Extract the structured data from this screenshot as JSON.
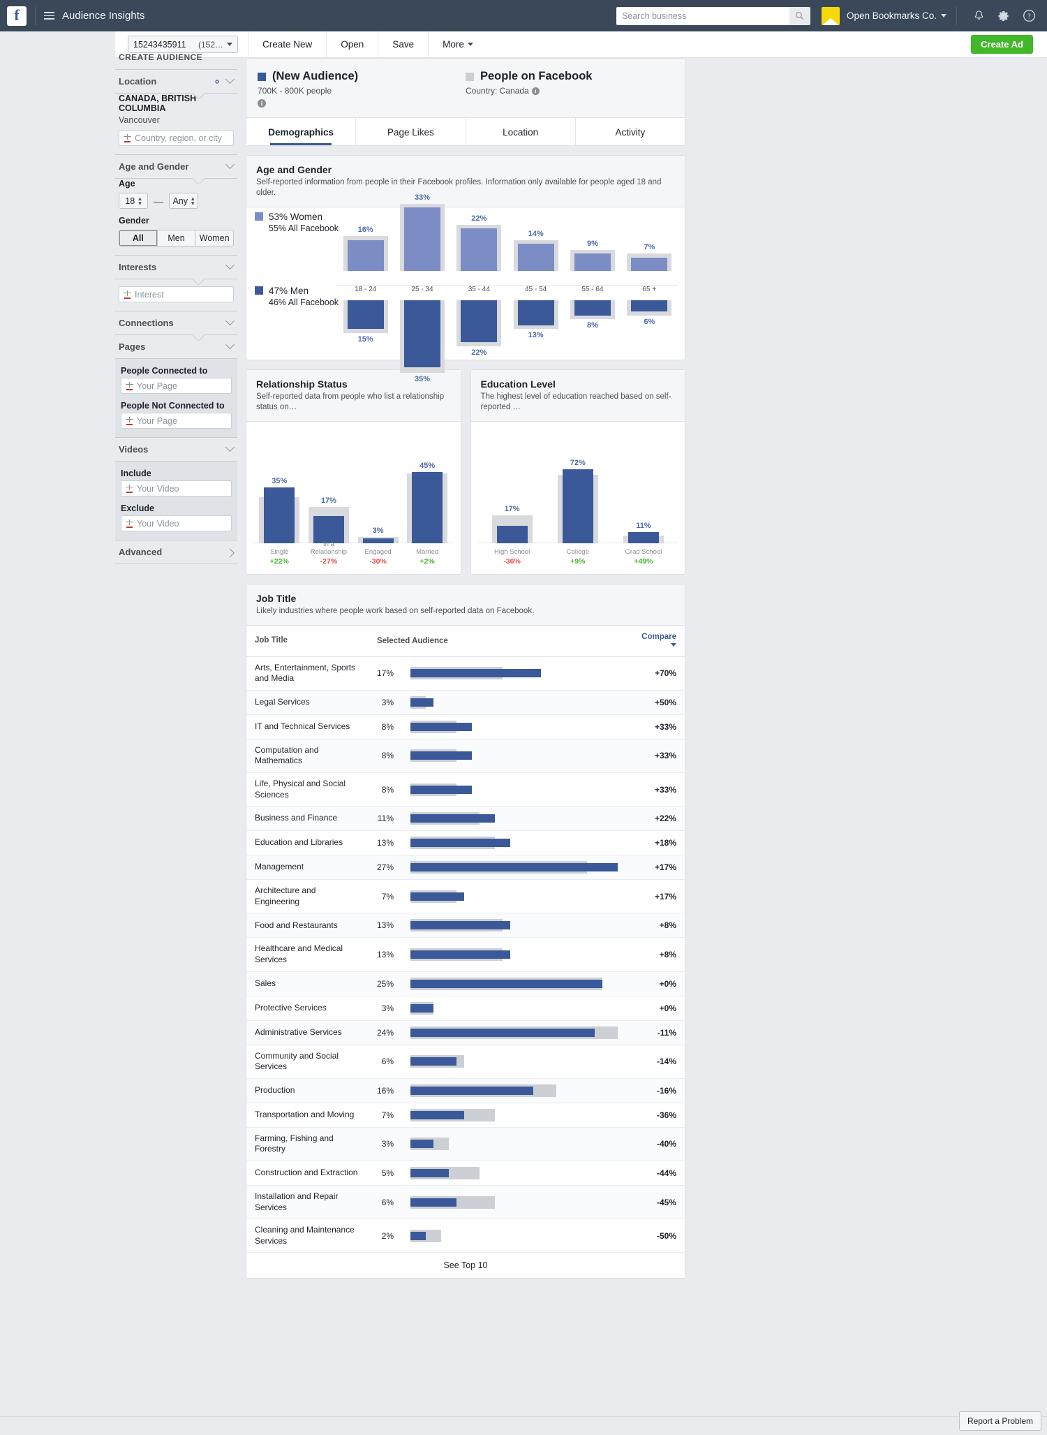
{
  "topbar": {
    "logo": "f",
    "menu_icon": "hamburger-icon",
    "title": "Audience Insights",
    "search_placeholder": "Search business",
    "search_value": "",
    "business_name": "Open Bookmarks Co.",
    "icons": [
      "bell-icon",
      "gear-icon",
      "help-icon"
    ]
  },
  "actionbar": {
    "audience_id": "15243435911",
    "audience_id_sub": "(152…",
    "create_new": "Create New",
    "open": "Open",
    "save": "Save",
    "more": "More",
    "create_ad": "Create Ad"
  },
  "sidebar": {
    "heading": "CREATE AUDIENCE",
    "location": {
      "label": "Location",
      "country_region": "CANADA, BRITISH COLUMBIA",
      "city": "Vancouver",
      "input_placeholder": "Country, region, or city"
    },
    "age_gender": {
      "label": "Age and Gender",
      "age_label": "Age",
      "age_min": "18",
      "age_max": "Any",
      "gender_label": "Gender",
      "gender_options": [
        "All",
        "Men",
        "Women"
      ],
      "gender_selected": "All"
    },
    "interests": {
      "label": "Interests",
      "input_placeholder": "Interest"
    },
    "connections": {
      "label": "Connections"
    },
    "pages": {
      "label": "Pages",
      "connected_label": "People Connected to",
      "connected_placeholder": "Your Page",
      "not_connected_label": "People Not Connected to",
      "not_connected_placeholder": "Your Page"
    },
    "videos": {
      "label": "Videos",
      "include_label": "Include",
      "include_placeholder": "Your Video",
      "exclude_label": "Exclude",
      "exclude_placeholder": "Your Video"
    },
    "advanced": {
      "label": "Advanced"
    }
  },
  "audience_header": {
    "selected_title": "(New Audience)",
    "selected_sub": "700K - 800K people",
    "compare_title": "People on Facebook",
    "compare_sub": "Country: Canada"
  },
  "tabs": [
    {
      "label": "Demographics",
      "active": true
    },
    {
      "label": "Page Likes",
      "active": false
    },
    {
      "label": "Location",
      "active": false
    },
    {
      "label": "Activity",
      "active": false
    }
  ],
  "age_gender_card": {
    "title": "Age and Gender",
    "description": "Self-reported information from people in their Facebook profiles. Information only available for people aged 18 and older.",
    "women_legend": "53% Women",
    "women_legend_sub": "55% All Facebook",
    "men_legend": "47% Men",
    "men_legend_sub": "46% All Facebook"
  },
  "relationship_card": {
    "title": "Relationship Status",
    "description": "Self-reported data from people who list a relationship status on…"
  },
  "education_card": {
    "title": "Education Level",
    "description": "The highest level of education reached based on self-reported …"
  },
  "job_title_card": {
    "title": "Job Title",
    "description": "Likely industries where people work based on self-reported data on Facebook.",
    "col_title": "Job Title",
    "col_audience": "Selected Audience",
    "col_compare": "Compare",
    "see_top": "See Top 10"
  },
  "footer": {
    "report_problem": "Report a Problem"
  },
  "colors": {
    "header_bg": "#3a4859",
    "men_blue": "#3b5998",
    "women_purple": "#7c8cc4",
    "facebook_gray": "#d8dade",
    "positive": "#42b72a",
    "negative": "#e64d4d",
    "cta_green": "#42b72a"
  },
  "chart_data": [
    {
      "type": "bar",
      "title": "Age and Gender",
      "xlabel": "",
      "ylabel": "",
      "categories": [
        "18 - 24",
        "25 - 34",
        "35 - 44",
        "45 - 54",
        "55 - 64",
        "65 +"
      ],
      "series": [
        {
          "name": "Women (Selected Audience)",
          "values": [
            16,
            33,
            22,
            14,
            9,
            7
          ]
        },
        {
          "name": "Men (Selected Audience)",
          "values": [
            15,
            35,
            22,
            13,
            8,
            6
          ]
        },
        {
          "name": "Women (All Facebook)",
          "values": [
            18,
            35,
            24,
            16,
            11,
            9
          ]
        },
        {
          "name": "Men (All Facebook)",
          "values": [
            17,
            38,
            24,
            15,
            10,
            8
          ]
        }
      ],
      "legend": [
        "53% Women / 55% All Facebook",
        "47% Men / 46% All Facebook"
      ],
      "grid": false
    },
    {
      "type": "bar",
      "title": "Relationship Status",
      "categories": [
        "Single",
        "In a Relationship",
        "Engaged",
        "Married"
      ],
      "values": [
        35,
        17,
        3,
        45
      ],
      "compare": [
        "+22%",
        "-27%",
        "-30%",
        "+2%"
      ],
      "compare_sign": [
        "pos",
        "neg",
        "neg",
        "pos"
      ],
      "all_facebook": [
        29,
        23,
        4,
        44
      ],
      "ylim": [
        0,
        50
      ],
      "grid": false
    },
    {
      "type": "bar",
      "title": "Education Level",
      "categories": [
        "High School",
        "College",
        "Grad School"
      ],
      "values": [
        17,
        72,
        11
      ],
      "compare": [
        "-36%",
        "+9%",
        "+49%"
      ],
      "compare_sign": [
        "neg",
        "pos",
        "pos"
      ],
      "all_facebook": [
        27,
        66,
        7
      ],
      "ylim": [
        0,
        80
      ],
      "grid": false
    },
    {
      "type": "bar",
      "title": "Job Title",
      "xlabel": "Selected Audience",
      "orientation": "horizontal",
      "categories": [
        "Arts, Entertainment, Sports and Media",
        "Legal Services",
        "IT and Technical Services",
        "Computation and Mathematics",
        "Life, Physical and Social Sciences",
        "Business and Finance",
        "Education and Libraries",
        "Management",
        "Architecture and Engineering",
        "Food and Restaurants",
        "Healthcare and Medical Services",
        "Sales",
        "Protective Services",
        "Administrative Services",
        "Community and Social Services",
        "Production",
        "Transportation and Moving",
        "Farming, Fishing and Forestry",
        "Construction and Extraction",
        "Installation and Repair Services",
        "Cleaning and Maintenance Services"
      ],
      "values": [
        17,
        3,
        8,
        8,
        8,
        11,
        13,
        27,
        7,
        13,
        13,
        25,
        3,
        24,
        6,
        16,
        7,
        3,
        5,
        6,
        2
      ],
      "compare": [
        "+70%",
        "+50%",
        "+33%",
        "+33%",
        "+33%",
        "+22%",
        "+18%",
        "+17%",
        "+17%",
        "+8%",
        "+8%",
        "+0%",
        "+0%",
        "-11%",
        "-14%",
        "-16%",
        "-36%",
        "-40%",
        "-44%",
        "-45%",
        "-50%"
      ]
    }
  ],
  "job_rows": [
    {
      "title": "Arts, Entertainment, Sports and Media",
      "pct": "17%",
      "fg": 17,
      "bg": 12,
      "cmp": "+70%",
      "sign": "pos"
    },
    {
      "title": "Legal Services",
      "pct": "3%",
      "fg": 3,
      "bg": 2,
      "cmp": "+50%",
      "sign": "pos"
    },
    {
      "title": "IT and Technical Services",
      "pct": "8%",
      "fg": 8,
      "bg": 6,
      "cmp": "+33%",
      "sign": "pos"
    },
    {
      "title": "Computation and Mathematics",
      "pct": "8%",
      "fg": 8,
      "bg": 6,
      "cmp": "+33%",
      "sign": "pos"
    },
    {
      "title": "Life, Physical and Social Sciences",
      "pct": "8%",
      "fg": 8,
      "bg": 6,
      "cmp": "+33%",
      "sign": "pos"
    },
    {
      "title": "Business and Finance",
      "pct": "11%",
      "fg": 11,
      "bg": 9,
      "cmp": "+22%",
      "sign": "pos"
    },
    {
      "title": "Education and Libraries",
      "pct": "13%",
      "fg": 13,
      "bg": 11,
      "cmp": "+18%",
      "sign": "pos"
    },
    {
      "title": "Management",
      "pct": "27%",
      "fg": 27,
      "bg": 23,
      "cmp": "+17%",
      "sign": "pos"
    },
    {
      "title": "Architecture and Engineering",
      "pct": "7%",
      "fg": 7,
      "bg": 6,
      "cmp": "+17%",
      "sign": "pos"
    },
    {
      "title": "Food and Restaurants",
      "pct": "13%",
      "fg": 13,
      "bg": 12,
      "cmp": "+8%",
      "sign": "pos"
    },
    {
      "title": "Healthcare and Medical Services",
      "pct": "13%",
      "fg": 13,
      "bg": 12,
      "cmp": "+8%",
      "sign": "pos"
    },
    {
      "title": "Sales",
      "pct": "25%",
      "fg": 25,
      "bg": 25,
      "cmp": "+0%",
      "sign": "zero"
    },
    {
      "title": "Protective Services",
      "pct": "3%",
      "fg": 3,
      "bg": 3,
      "cmp": "+0%",
      "sign": "zero"
    },
    {
      "title": "Administrative Services",
      "pct": "24%",
      "fg": 24,
      "bg": 27,
      "cmp": "-11%",
      "sign": "neg"
    },
    {
      "title": "Community and Social Services",
      "pct": "6%",
      "fg": 6,
      "bg": 7,
      "cmp": "-14%",
      "sign": "neg"
    },
    {
      "title": "Production",
      "pct": "16%",
      "fg": 16,
      "bg": 19,
      "cmp": "-16%",
      "sign": "neg"
    },
    {
      "title": "Transportation and Moving",
      "pct": "7%",
      "fg": 7,
      "bg": 11,
      "cmp": "-36%",
      "sign": "neg"
    },
    {
      "title": "Farming, Fishing and Forestry",
      "pct": "3%",
      "fg": 3,
      "bg": 5,
      "cmp": "-40%",
      "sign": "neg"
    },
    {
      "title": "Construction and Extraction",
      "pct": "5%",
      "fg": 5,
      "bg": 9,
      "cmp": "-44%",
      "sign": "neg"
    },
    {
      "title": "Installation and Repair Services",
      "pct": "6%",
      "fg": 6,
      "bg": 11,
      "cmp": "-45%",
      "sign": "neg"
    },
    {
      "title": "Cleaning and Maintenance Services",
      "pct": "2%",
      "fg": 2,
      "bg": 4,
      "cmp": "-50%",
      "sign": "neg"
    }
  ]
}
